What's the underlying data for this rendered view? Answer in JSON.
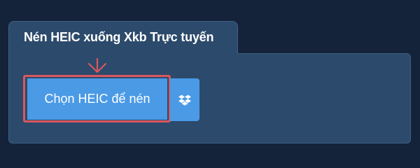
{
  "panel": {
    "title": "Nén HEIC xuống Xkb Trực tuyến"
  },
  "upload": {
    "choose_label": "Chọn HEIC để nén",
    "dropbox_icon": "dropbox-icon"
  },
  "colors": {
    "background": "#14233a",
    "panel": "#2c4a6b",
    "button": "#4a9ae6",
    "highlight": "#d9575f"
  }
}
